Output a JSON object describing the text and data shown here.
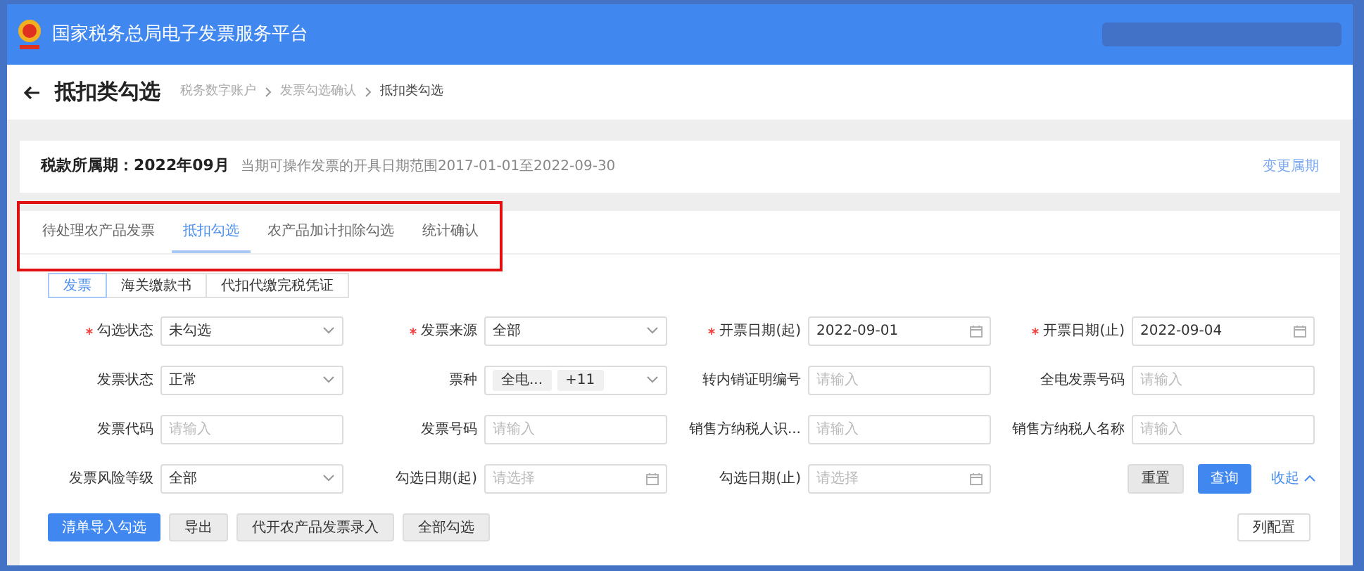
{
  "header": {
    "title": "国家税务总局电子发票服务平台"
  },
  "page": {
    "title": "抵扣类勾选",
    "breadcrumb": [
      "税务数字账户",
      "发票勾选确认",
      "抵扣类勾选"
    ]
  },
  "period": {
    "label": "税款所属期：2022年09月",
    "note": "当期可操作发票的开具日期范围2017-01-01至2022-09-30",
    "link": "变更属期"
  },
  "tabs": [
    {
      "label": "待处理农产品发票",
      "selected": false
    },
    {
      "label": "抵扣勾选",
      "selected": true
    },
    {
      "label": "农产品加计扣除勾选",
      "selected": false
    },
    {
      "label": "统计确认",
      "selected": false
    }
  ],
  "doc_types": [
    {
      "label": "发票",
      "selected": true
    },
    {
      "label": "海关缴款书",
      "selected": false
    },
    {
      "label": "代扣代缴完税凭证",
      "selected": false
    }
  ],
  "filters": [
    {
      "label": "勾选状态",
      "required": true,
      "kind": "select",
      "value": "未勾选"
    },
    {
      "label": "发票来源",
      "required": true,
      "kind": "select",
      "value": "全部"
    },
    {
      "label": "开票日期(起)",
      "required": true,
      "kind": "date",
      "value": "2022-09-01"
    },
    {
      "label": "开票日期(止)",
      "required": true,
      "kind": "date",
      "value": "2022-09-04"
    },
    {
      "label": "发票状态",
      "required": false,
      "kind": "select",
      "value": "正常"
    },
    {
      "label": "票种",
      "required": false,
      "kind": "tags",
      "tags": [
        "全电...",
        "+11"
      ]
    },
    {
      "label": "转内销证明编号",
      "required": false,
      "kind": "text",
      "placeholder": "请输入"
    },
    {
      "label": "全电发票号码",
      "required": false,
      "kind": "text",
      "placeholder": "请输入"
    },
    {
      "label": "发票代码",
      "required": false,
      "kind": "text",
      "placeholder": "请输入"
    },
    {
      "label": "发票号码",
      "required": false,
      "kind": "text",
      "placeholder": "请输入"
    },
    {
      "label": "销售方纳税人识...",
      "required": false,
      "kind": "text",
      "placeholder": "请输入"
    },
    {
      "label": "销售方纳税人名称",
      "required": false,
      "kind": "text",
      "placeholder": "请输入"
    },
    {
      "label": "发票风险等级",
      "required": false,
      "kind": "select",
      "value": "全部"
    },
    {
      "label": "勾选日期(起)",
      "required": false,
      "kind": "date",
      "placeholder": "请选择"
    },
    {
      "label": "勾选日期(止)",
      "required": false,
      "kind": "date",
      "placeholder": "请选择"
    }
  ],
  "form_actions": {
    "reset": "重置",
    "query": "查询",
    "collapse": "收起"
  },
  "buttons": [
    {
      "label": "清单导入勾选",
      "primary": true
    },
    {
      "label": "导出",
      "primary": false
    },
    {
      "label": "代开农产品发票录入",
      "primary": false
    },
    {
      "label": "全部勾选",
      "primary": false
    }
  ],
  "column_config": "列配置"
}
